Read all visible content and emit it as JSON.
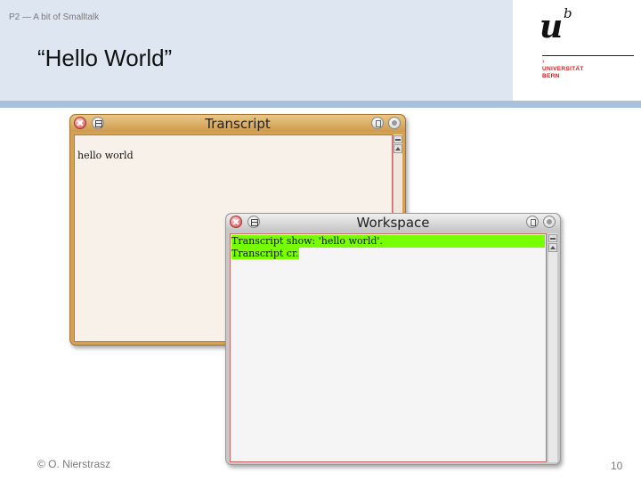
{
  "slide": {
    "course_label": "P2 — A bit of Smalltalk",
    "title": "“Hello World”",
    "logo": {
      "u": "u",
      "b": "b",
      "line1": "UNIVERSITÄT",
      "line2": "BERN"
    },
    "footer": {
      "copyright": "© O. Nierstrasz",
      "page_number": "10"
    }
  },
  "windows": {
    "transcript": {
      "title": "Transcript",
      "content": "hello world",
      "icons": [
        "close-icon",
        "window-menu-icon",
        "collapse-icon",
        "expand-icon"
      ],
      "colors": {
        "frame": "#d5a155",
        "pane": "#f8f1ea"
      }
    },
    "workspace": {
      "title": "Workspace",
      "lines": [
        "Transcript show: 'hello world'.",
        "Transcript cr."
      ],
      "selection_color": "#77ff00",
      "icons": [
        "close-icon",
        "window-menu-icon",
        "collapse-icon",
        "expand-icon"
      ],
      "colors": {
        "frame": "#c8c8c8",
        "pane": "#f5f5f5"
      }
    }
  }
}
